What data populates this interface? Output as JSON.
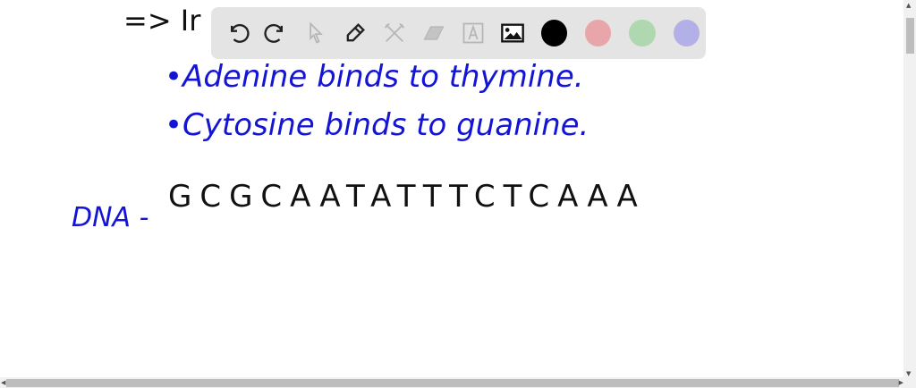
{
  "canvas": {
    "heading": "=> Ir",
    "bullets": [
      "•Adenine binds to thymine.",
      "•Cytosine binds to guanine."
    ],
    "dna_label": "DNA -",
    "dna_sequence": "GCGCAATATTTCTCAAA"
  },
  "toolbar": {
    "tools": [
      "undo-icon",
      "redo-icon",
      "select-icon",
      "pen-icon",
      "tools-icon",
      "eraser-icon",
      "text-icon",
      "image-icon"
    ],
    "colors": [
      "#000000",
      "#e8a6ab",
      "#b0d8b0",
      "#b3b0e8"
    ]
  },
  "colors": {
    "ink_black": "#111111",
    "ink_blue": "#1414d4"
  }
}
